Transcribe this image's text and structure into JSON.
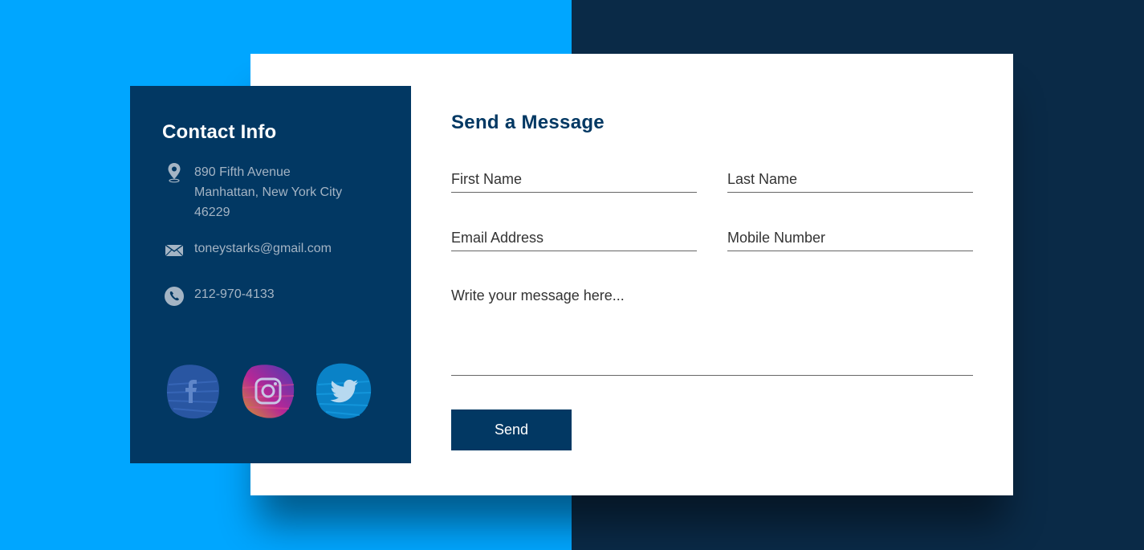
{
  "colors": {
    "bg_left": "#00a6ff",
    "bg_right": "#0a2a47",
    "info_card": "#023863",
    "accent": "#023863",
    "facebook": "#3b5998",
    "twitter": "#1da1f2"
  },
  "contact_info": {
    "title": "Contact Info",
    "address": {
      "icon": "location-pin-icon",
      "line1": "890 Fifth Avenue",
      "line2": "Manhattan, New York City",
      "line3": "46229"
    },
    "email": {
      "icon": "mail-icon",
      "value": "toneystarks@gmail.com"
    },
    "phone": {
      "icon": "phone-icon",
      "value": "212-970-4133"
    },
    "social": [
      {
        "name": "facebook",
        "icon": "facebook-icon"
      },
      {
        "name": "instagram",
        "icon": "instagram-icon"
      },
      {
        "name": "twitter",
        "icon": "twitter-icon"
      }
    ]
  },
  "form": {
    "title": "Send a Message",
    "first_name": {
      "placeholder": "First Name",
      "value": ""
    },
    "last_name": {
      "placeholder": "Last Name",
      "value": ""
    },
    "email": {
      "placeholder": "Email Address",
      "value": ""
    },
    "mobile": {
      "placeholder": "Mobile Number",
      "value": ""
    },
    "message": {
      "placeholder": "Write your message here...",
      "value": ""
    },
    "send_label": "Send"
  }
}
